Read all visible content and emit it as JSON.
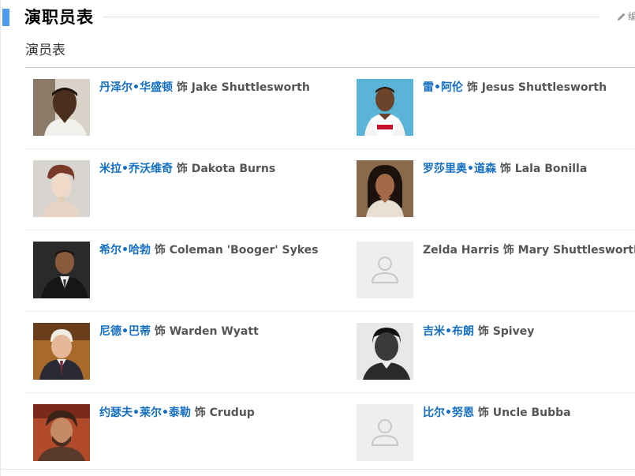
{
  "section": {
    "title": "演职员表",
    "edit_label": "编",
    "subtitle": "演员表"
  },
  "cast": [
    {
      "actor": "丹泽尔•华盛顿",
      "actor_linked": true,
      "sep": " 饰 ",
      "role": "Jake Shuttlesworth",
      "photo": "portrait"
    },
    {
      "actor": "雷•阿伦",
      "actor_linked": true,
      "sep": " 饰 ",
      "role": "Jesus Shuttlesworth",
      "photo": "portrait"
    },
    {
      "actor": "米拉•乔沃维奇",
      "actor_linked": true,
      "sep": " 饰 ",
      "role": "Dakota Burns",
      "photo": "portrait"
    },
    {
      "actor": "罗莎里奥•道森",
      "actor_linked": true,
      "sep": " 饰 ",
      "role": "Lala Bonilla",
      "photo": "portrait"
    },
    {
      "actor": "希尔•哈勃",
      "actor_linked": true,
      "sep": " 饰 ",
      "role": "Coleman 'Booger' Sykes",
      "photo": "portrait"
    },
    {
      "actor": "Zelda Harris",
      "actor_linked": false,
      "sep": " 饰 ",
      "role": "Mary Shuttlesworth",
      "photo": "placeholder"
    },
    {
      "actor": "尼德•巴蒂",
      "actor_linked": true,
      "sep": " 饰 ",
      "role": "Warden Wyatt",
      "photo": "portrait"
    },
    {
      "actor": "吉米•布朗",
      "actor_linked": true,
      "sep": " 饰 ",
      "role": "Spivey",
      "photo": "portrait"
    },
    {
      "actor": "约瑟夫•莱尔•泰勒",
      "actor_linked": true,
      "sep": " 饰 ",
      "role": "Crudup",
      "photo": "portrait"
    },
    {
      "actor": "比尔•努恩",
      "actor_linked": true,
      "sep": " 饰 ",
      "role": "Uncle Bubba",
      "photo": "placeholder"
    }
  ],
  "colors": {
    "accent": "#4f9cee",
    "link": "#136ec2",
    "role_text": "#555555",
    "placeholder_bg": "#eeeeee",
    "placeholder_icon": "#c8c8c8"
  }
}
